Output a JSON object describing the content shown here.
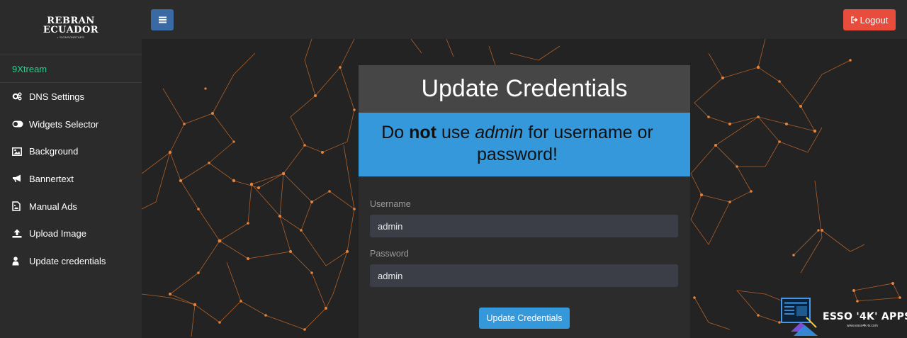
{
  "logo": {
    "line1": "REBRAN",
    "line2": "ECUADOR",
    "line3": "• SIGNSONSTARS"
  },
  "sidebar": {
    "active": "9Xtream",
    "items": [
      {
        "label": "DNS Settings",
        "icon": "gears-icon"
      },
      {
        "label": "Widgets Selector",
        "icon": "toggle-icon"
      },
      {
        "label": "Background",
        "icon": "image-icon"
      },
      {
        "label": "Bannertext",
        "icon": "bullhorn-icon"
      },
      {
        "label": "Manual Ads",
        "icon": "file-image-icon"
      },
      {
        "label": "Upload Image",
        "icon": "upload-icon"
      },
      {
        "label": "Update credentials",
        "icon": "user-icon"
      }
    ]
  },
  "topbar": {
    "logout_label": "Logout"
  },
  "card": {
    "title": "Update Credentials",
    "warning": {
      "pre": "Do ",
      "bold": "not",
      "mid": " use ",
      "italic": "admin",
      "post": " for username or password!"
    },
    "username_label": "Username",
    "username_value": "admin",
    "password_label": "Password",
    "password_value": "admin",
    "submit_label": "Update Credentials"
  },
  "watermark": {
    "title": "ESSO '4K' APPS",
    "subtitle": "www.esso4k-tv.com"
  },
  "colors": {
    "accent_green": "#2ecc8f",
    "primary_blue": "#3498db",
    "menu_button": "#3a6aa4",
    "danger_red": "#e74c3c",
    "network_orange": "#e8843a"
  }
}
